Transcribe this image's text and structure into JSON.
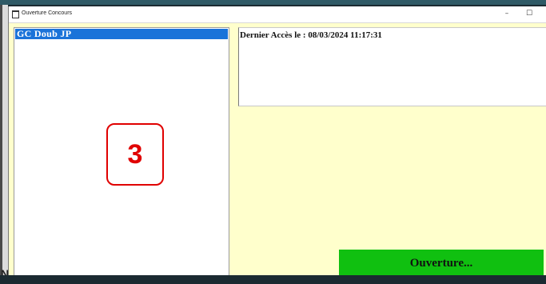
{
  "window": {
    "title": "Ouverture Concours",
    "minimize_glyph": "–",
    "maximize_glyph": "☐"
  },
  "list": {
    "items": [
      {
        "label": "GC  Doub  JP",
        "selected": true
      }
    ]
  },
  "annotation": {
    "step_number": "3",
    "color": "#e00000"
  },
  "info": {
    "last_access": "Dernier Accès le : 08/03/2024 11:17:31"
  },
  "actions": {
    "open_label": "Ouverture..."
  },
  "colors": {
    "client_background": "#ffffcc",
    "selection": "#1a73d9",
    "open_button": "#10c010"
  },
  "icons": [
    "window-app-icon",
    "minimize-icon",
    "maximize-icon"
  ]
}
